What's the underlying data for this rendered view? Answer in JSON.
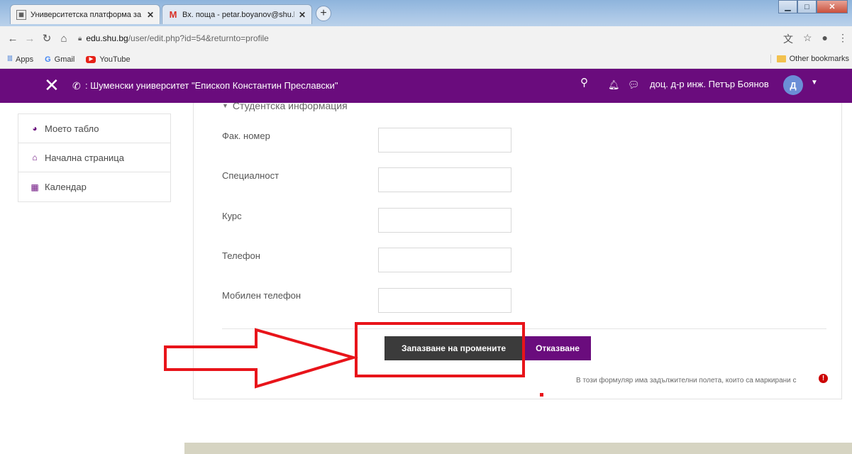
{
  "browser": {
    "tabs": [
      {
        "title": "Университетска платформа за с",
        "close": "✕",
        "active": true
      },
      {
        "title": "Вх. поща - petar.boyanov@shu.b",
        "close": "✕",
        "active": false
      }
    ],
    "new_tab": "+",
    "url_host": "edu.shu.bg",
    "url_path": "/user/edit.php?id=54&returnto=profile",
    "bookmarks": [
      {
        "label": "Apps",
        "icon": "apps-grid-icon"
      },
      {
        "label": "Gmail",
        "icon": "google-icon"
      },
      {
        "label": "YouTube",
        "icon": "youtube-icon"
      }
    ],
    "other_bookmarks": "Other bookmarks"
  },
  "header": {
    "university": ": Шуменски университет \"Епископ Константин Преславски\"",
    "user_name": "доц. д-р инж. Петър Боянов",
    "avatar_letter": "Д",
    "brand_color": "#6a0c7d"
  },
  "sidebar": {
    "items": [
      {
        "label": "Моето табло",
        "icon": "dashboard-icon"
      },
      {
        "label": "Начална страница",
        "icon": "home-icon"
      },
      {
        "label": "Календар",
        "icon": "calendar-icon"
      }
    ]
  },
  "form": {
    "section_title": "Студентска информация",
    "fields": [
      {
        "label": "Фак. номер",
        "value": ""
      },
      {
        "label": "Специалност",
        "value": ""
      },
      {
        "label": "Курс",
        "value": ""
      },
      {
        "label": "Телефон",
        "value": ""
      },
      {
        "label": "Мобилен телефон",
        "value": ""
      }
    ],
    "save_label": "Запазване на промените",
    "cancel_label": "Отказване",
    "required_note": "В този формуляр има задължителни полета, които са маркирани с"
  },
  "annotation": {
    "color": "#e8141a",
    "shapes": [
      "arrow",
      "highlight-box"
    ]
  }
}
